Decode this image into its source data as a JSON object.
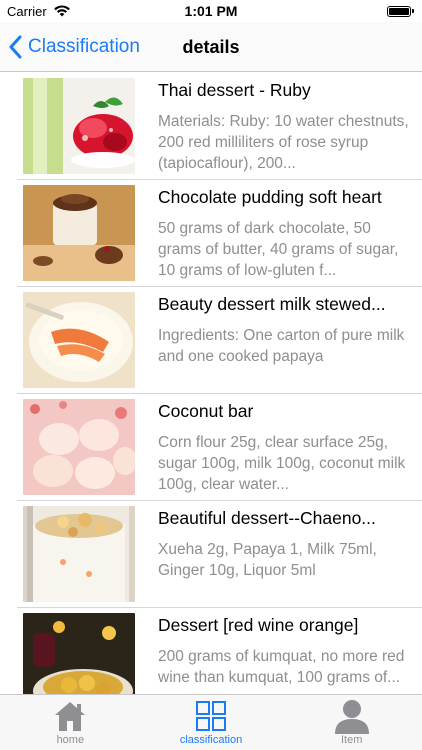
{
  "status_bar": {
    "carrier": "Carrier",
    "time": "1:01 PM",
    "icons": [
      "wifi-icon",
      "battery-icon"
    ]
  },
  "nav": {
    "back_label": "Classification",
    "title": "details",
    "accent_color": "#1a7cf5"
  },
  "items": [
    {
      "title": "Thai dessert - Ruby",
      "description": "Materials: Ruby: 10 water chestnuts, 200 red milliliters of rose syrup (tapiocaflour), 200..."
    },
    {
      "title": "Chocolate pudding soft heart",
      "description": "50 grams of dark chocolate, 50 grams of butter, 40 grams of sugar, 10 grams of low-gluten f..."
    },
    {
      "title": "Beauty dessert milk stewed...",
      "description": "Ingredients: One carton of pure milk and one cooked papaya"
    },
    {
      "title": "Coconut bar",
      "description": "Corn flour 25g, clear surface 25g, sugar 100g, milk 100g, coconut milk 100g, clear water..."
    },
    {
      "title": "Beautiful dessert--Chaeno...",
      "description": "Xueha 2g, Papaya 1, Milk 75ml, Ginger 10g, Liquor 5ml"
    },
    {
      "title": "Dessert [red wine orange]",
      "description": "200 grams of kumquat, no more red wine than kumquat, 100 grams of..."
    }
  ],
  "tabs": [
    {
      "label": "home",
      "icon": "home-icon",
      "active": false
    },
    {
      "label": "classification",
      "icon": "grid-icon",
      "active": true
    },
    {
      "label": "Item",
      "icon": "person-icon",
      "active": false
    }
  ]
}
